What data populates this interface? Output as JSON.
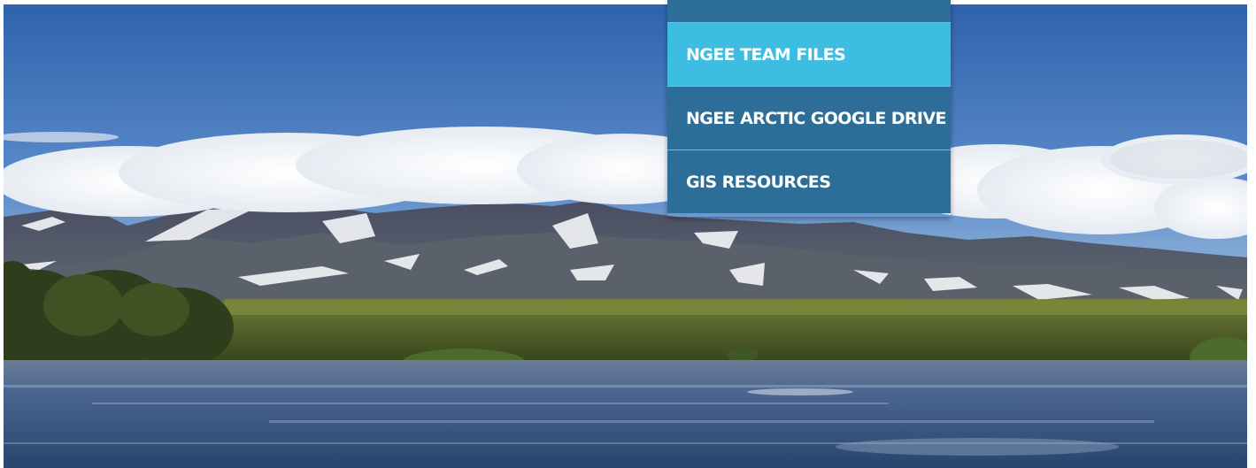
{
  "dropdown": {
    "items": [
      {
        "label": "NGEE TEAM FILES",
        "active": true
      },
      {
        "label": "NGEE ARCTIC GOOGLE DRIVE",
        "active": false
      },
      {
        "label": "GIS RESOURCES",
        "active": false
      }
    ]
  },
  "colors": {
    "menu_bg": "#2c6e97",
    "menu_active_bg": "#3dbde2",
    "menu_text": "#ffffff",
    "sky": "#3d6fb6",
    "water": "#3f5f8a",
    "tundra": "#4f6426"
  }
}
